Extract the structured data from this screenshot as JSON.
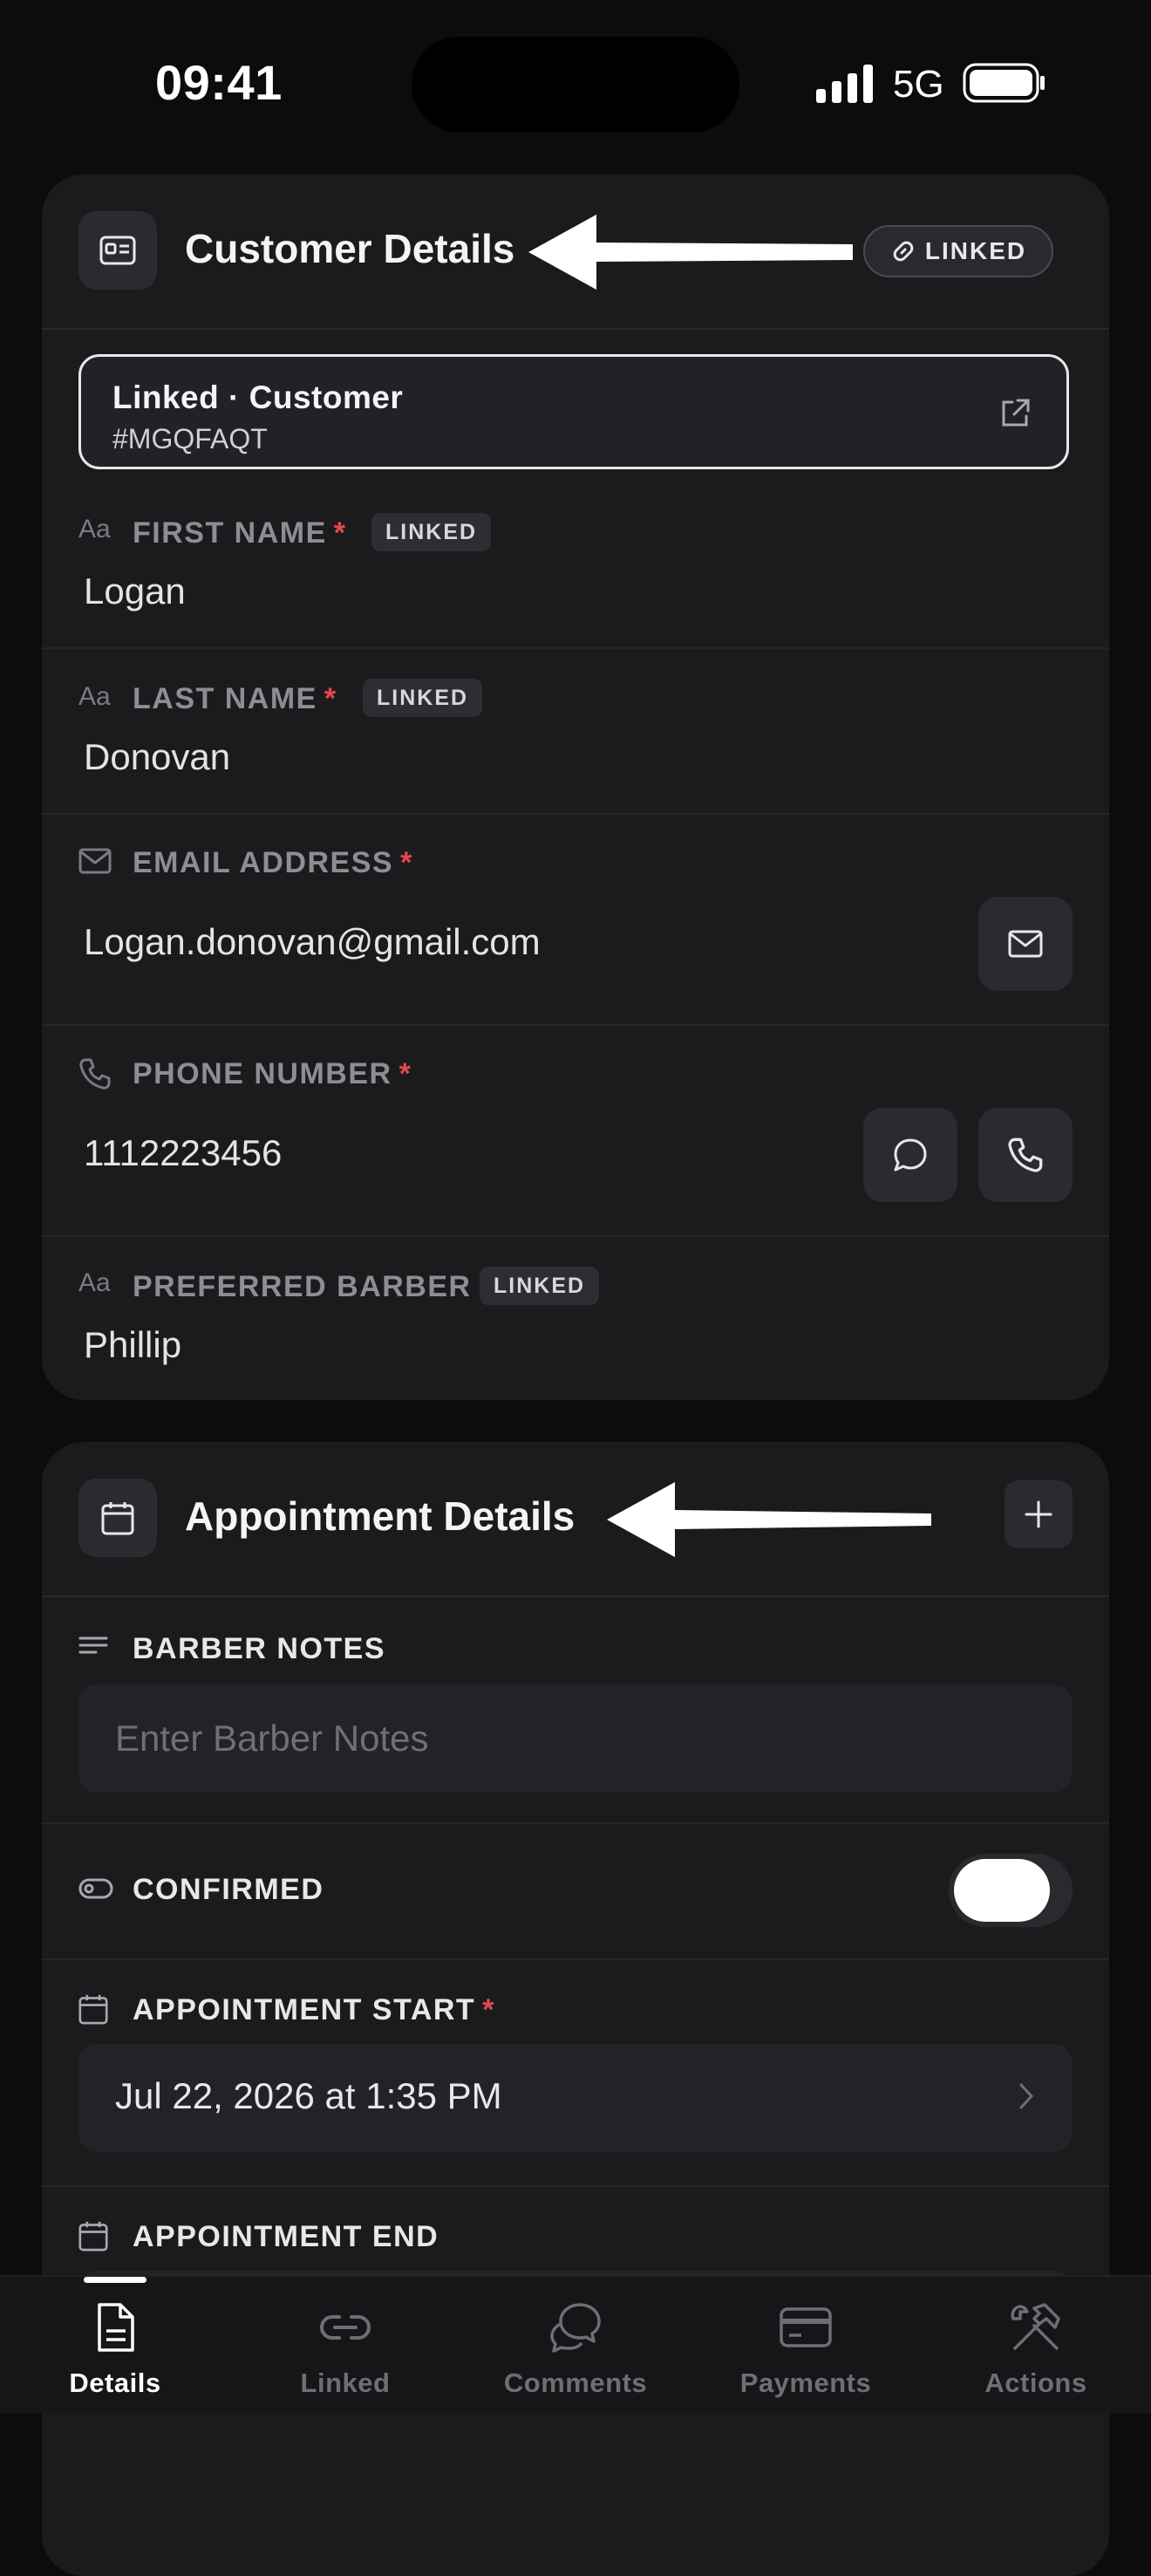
{
  "status_bar": {
    "time": "09:41",
    "network": "5G"
  },
  "customer_card": {
    "title": "Customer Details",
    "linked_badge": "LINKED",
    "linked_record": {
      "title": "Linked · Customer",
      "id": "#MGQFAQT"
    },
    "fields": {
      "first_name": {
        "label": "FIRST NAME",
        "required": "*",
        "tag": "LINKED",
        "value": "Logan"
      },
      "last_name": {
        "label": "LAST NAME",
        "required": "*",
        "tag": "LINKED",
        "value": "Donovan"
      },
      "email": {
        "label": "EMAIL ADDRESS",
        "required": "*",
        "value": "Logan.donovan@gmail.com"
      },
      "phone": {
        "label": "PHONE NUMBER",
        "required": "*",
        "value": "1112223456"
      },
      "barber": {
        "label": "PREFERRED BARBER",
        "tag": "LINKED",
        "value": "Phillip"
      }
    }
  },
  "appointment_card": {
    "title": "Appointment Details",
    "barber_notes": {
      "label": "BARBER NOTES",
      "placeholder": "Enter Barber Notes"
    },
    "confirmed": {
      "label": "CONFIRMED",
      "on": true
    },
    "start": {
      "label": "APPOINTMENT START",
      "required": "*",
      "value": "Jul 22, 2026 at 1:35 PM"
    },
    "end": {
      "label": "APPOINTMENT END"
    }
  },
  "tabs": [
    {
      "label": "Details",
      "icon": "document-icon",
      "active": true
    },
    {
      "label": "Linked",
      "icon": "link-icon"
    },
    {
      "label": "Comments",
      "icon": "comments-icon"
    },
    {
      "label": "Payments",
      "icon": "card-icon"
    },
    {
      "label": "Actions",
      "icon": "tools-icon"
    }
  ],
  "colors": {
    "background": "#0c0c0d",
    "card": "#1b1b1e",
    "required": "#e5484d",
    "accent": "#ffffff"
  }
}
